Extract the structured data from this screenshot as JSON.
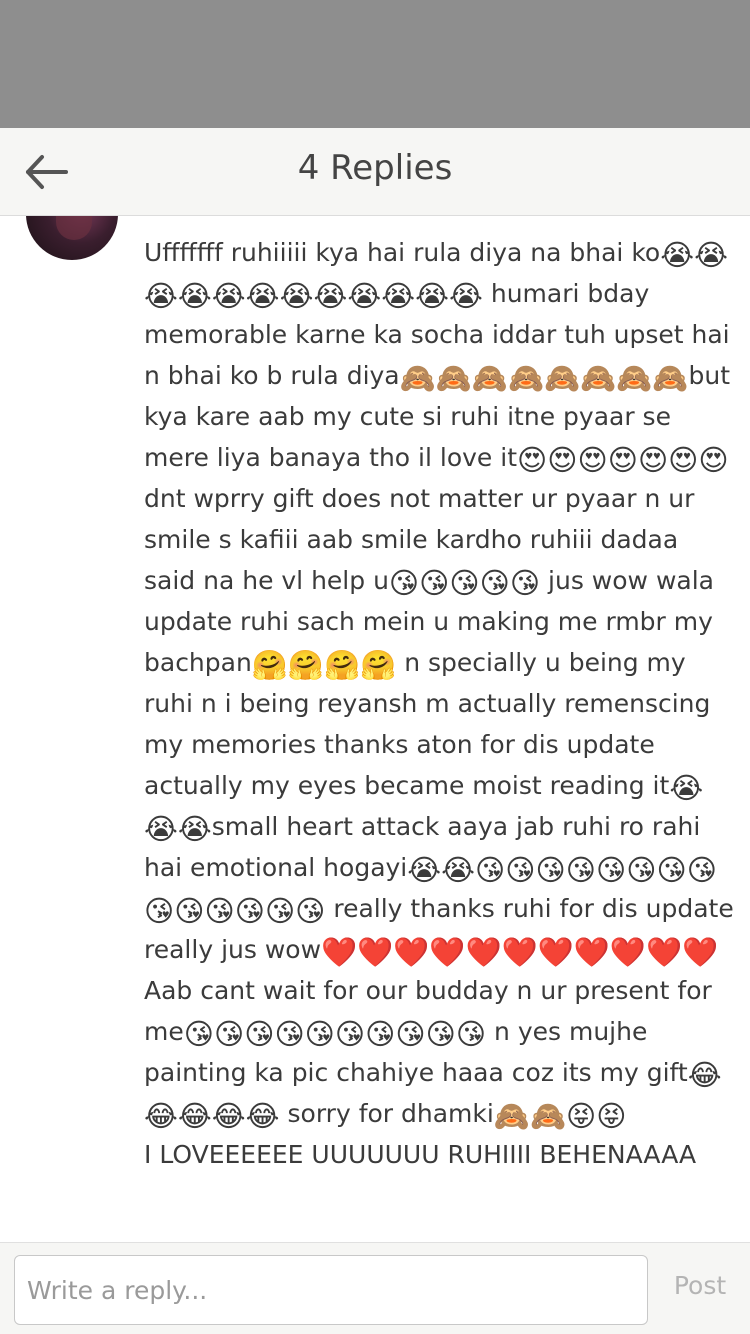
{
  "header": {
    "title": "4 Replies"
  },
  "reply": {
    "avatar_icon": "user-avatar-photo",
    "text": "Ufffffff ruhiiiii kya hai rula diya na bhai ko😭😭😭😭😭😭😭😭😭😭😭😭 humari bday memorable karne ka socha iddar tuh upset hai n bhai ko b rula diya🙈🙈🙈🙈🙈🙈🙈🙈but kya kare aab my cute si ruhi itne pyaar se mere liya banaya tho il love it😍😍😍😍😍😍😍 dnt wprry gift does not matter ur pyaar n ur smile s kafiii aab smile kardho ruhiii dadaa said na he vl help u😘😘😘😘😘 jus wow wala update ruhi sach mein u making me rmbr my bachpan🤗🤗🤗🤗 n specially u being my ruhi n i being reyansh m actually remenscing my memories thanks aton for dis update actually my eyes became moist reading it😭😭😭small heart attack  aaya jab ruhi ro rahi hai emotional hogayi😭😭😘😘😘😘😘😘😘😘😘😘😘😘😘😘 really thanks ruhi for dis update really jus wow❤️❤️❤️❤️❤️❤️❤️❤️❤️❤️❤️\nAab cant wait for our budday n ur present for me😘😘😘😘😘😘😘😘😘😘 n yes mujhe painting ka pic chahiye haaa coz its my gift😂😂😂😂😂 sorry for dhamki🙈🙈😝😝\nI LOVEEEEEE UUUUUUU RUHIIII BEHENAAAA"
  },
  "composer": {
    "placeholder": "Write a reply...",
    "post_label": "Post"
  },
  "colors": {
    "status_shade": "#8e8e8e",
    "header_bg": "#f6f6f4",
    "text": "#3b3b3b",
    "post_disabled": "#b4b4b4"
  }
}
